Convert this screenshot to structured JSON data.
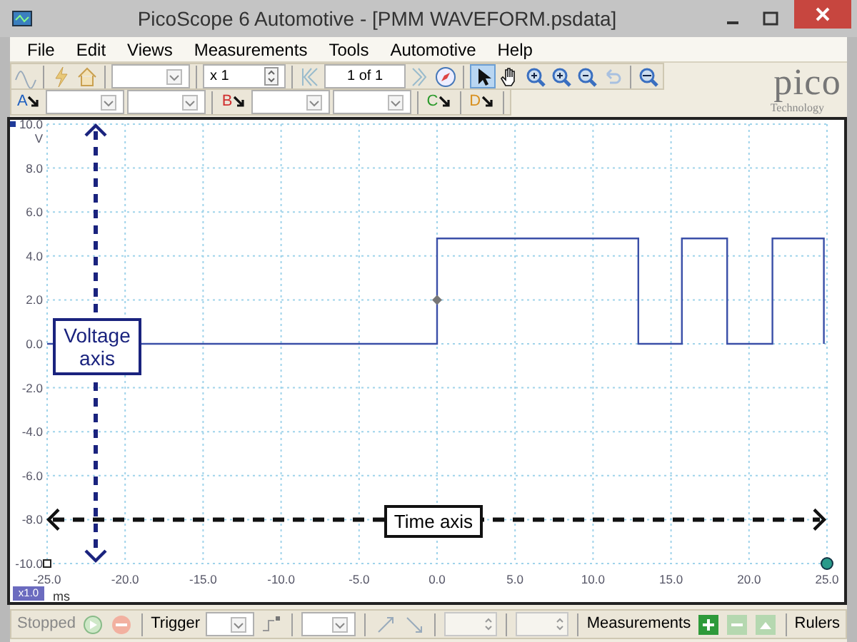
{
  "window": {
    "title": "PicoScope 6 Automotive - [PMM WAVEFORM.psdata]"
  },
  "menu": [
    "File",
    "Edit",
    "Views",
    "Measurements",
    "Tools",
    "Automotive",
    "Help"
  ],
  "toolbar": {
    "zoom": "x 1",
    "page": "1 of 1"
  },
  "logo": {
    "text": "pico",
    "subtext": "Technology"
  },
  "channels": [
    {
      "label": "A",
      "color": "#1f5fbf"
    },
    {
      "label": "B",
      "color": "#d03030"
    },
    {
      "label": "C",
      "color": "#2a9a2a"
    },
    {
      "label": "D",
      "color": "#d89020"
    }
  ],
  "scope": {
    "x_scale": "x1.0",
    "overlays": [
      {
        "text": "Voltage axis",
        "kind": "vertical"
      },
      {
        "text": "Time axis",
        "kind": "horizontal"
      }
    ],
    "chart_data": {
      "type": "line",
      "xlabel": "ms",
      "ylabel": "V",
      "xlim": [
        -25,
        25
      ],
      "ylim": [
        -10,
        10
      ],
      "grid": true,
      "xticks": [
        {
          "value": -25,
          "label": "-25.0"
        },
        {
          "value": -20,
          "label": "-20.0"
        },
        {
          "value": -15,
          "label": "-15.0"
        },
        {
          "value": -10,
          "label": "-10.0"
        },
        {
          "value": -5,
          "label": "-5.0"
        },
        {
          "value": 0,
          "label": "0.0"
        },
        {
          "value": 5,
          "label": "5.0"
        },
        {
          "value": 10,
          "label": "10.0"
        },
        {
          "value": 15,
          "label": "15.0"
        },
        {
          "value": 20,
          "label": "20.0"
        },
        {
          "value": 25,
          "label": "25.0"
        }
      ],
      "yticks": [
        {
          "value": 10,
          "label": "10.0"
        },
        {
          "value": 8,
          "label": "8.0"
        },
        {
          "value": 6,
          "label": "6.0"
        },
        {
          "value": 4,
          "label": "4.0"
        },
        {
          "value": 2,
          "label": "2.0"
        },
        {
          "value": 0,
          "label": "0.0"
        },
        {
          "value": -2,
          "label": "-2.0"
        },
        {
          "value": -4,
          "label": "-4.0"
        },
        {
          "value": -6,
          "label": "-6.0"
        },
        {
          "value": -8,
          "label": "-8.0"
        },
        {
          "value": -10,
          "label": "-10.0"
        }
      ],
      "x": [
        -25,
        0,
        0,
        12.9,
        12.9,
        15.7,
        15.7,
        18.6,
        18.6,
        21.5,
        21.5,
        24.8,
        24.8
      ],
      "series": [
        {
          "color": "#3a4fa8",
          "values": [
            0,
            0,
            4.8,
            4.8,
            0,
            0,
            4.8,
            4.8,
            0,
            0,
            4.8,
            4.8,
            0
          ]
        }
      ]
    }
  },
  "status_bar": {
    "state": "Stopped",
    "trigger": "Trigger",
    "measurements": "Measurements",
    "rulers": "Rulers"
  }
}
